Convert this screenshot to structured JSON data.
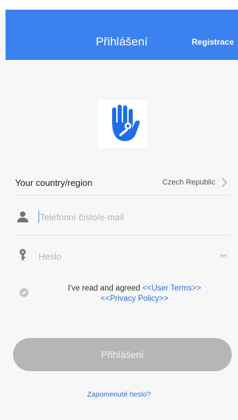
{
  "header": {
    "title": "Přihlášení",
    "register_label": "Registrace"
  },
  "colors": {
    "primary": "#3b82f0",
    "link": "#2d6fd8",
    "button_disabled": "#b6b6b6"
  },
  "icons": {
    "logo": "hand-key-icon",
    "user": "user-icon",
    "password": "key-icon",
    "visibility": "eye-closed-icon",
    "check": "check-circle-icon",
    "chevron": "chevron-right-icon"
  },
  "country": {
    "label": "Your country/region",
    "value": "Czech Republic"
  },
  "form": {
    "phone_placeholder": "Telefonní číslo/e-mail",
    "password_placeholder": "Heslo"
  },
  "agreement": {
    "prefix": "I've read and agreed ",
    "terms_link": "<<User Terms>>",
    "privacy_link": "<<Privacy Policy>>"
  },
  "login_button": "Přihlášení",
  "forgot_password": "Zapomenuté heslo?"
}
